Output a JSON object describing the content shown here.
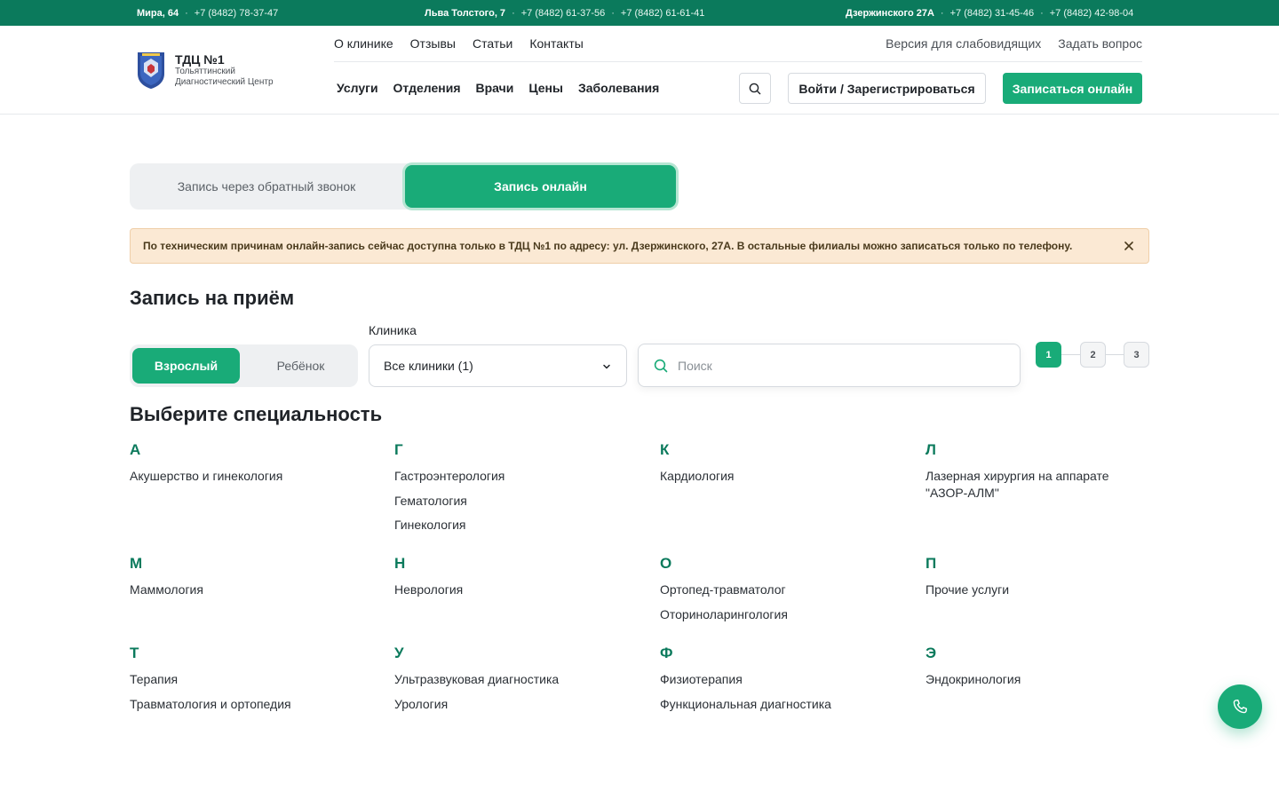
{
  "topbar": {
    "branches": [
      {
        "address": "Мира, 64",
        "phones": [
          "+7 (8482) 78-37-47"
        ]
      },
      {
        "address": "Льва Толстого, 7",
        "phones": [
          "+7 (8482) 61-37-56",
          "+7 (8482) 61-61-41"
        ]
      },
      {
        "address": "Дзержинского 27А",
        "phones": [
          "+7 (8482) 31-45-46",
          "+7 (8482) 42-98-04"
        ]
      }
    ]
  },
  "logo": {
    "title": "ТДЦ №1",
    "subtitle_line1": "Тольяттинский",
    "subtitle_line2": "Диагностический Центр"
  },
  "header": {
    "top_nav": [
      "О клинике",
      "Отзывы",
      "Статьи",
      "Контакты"
    ],
    "top_right": [
      "Версия для слабовидящих",
      "Задать вопрос"
    ],
    "main_nav": [
      "Услуги",
      "Отделения",
      "Врачи",
      "Цены",
      "Заболевания"
    ],
    "login_label": "Войти / Зарегистрироваться",
    "cta_label": "Записаться онлайн"
  },
  "mode": {
    "callback_label": "Запись через обратный звонок",
    "online_label": "Запись онлайн"
  },
  "alert": {
    "text": "По техническим причинам онлайн-запись сейчас доступна только в ТДЦ №1 по адресу: ул. Дзержинского, 27А. В остальные филиалы можно записаться только по телефону."
  },
  "booking": {
    "title": "Запись на приём",
    "adult_label": "Взрослый",
    "child_label": "Ребёнок",
    "clinic_label": "Клиника",
    "clinic_value": "Все клиники (1)",
    "search_placeholder": "Поиск",
    "steps": [
      "1",
      "2",
      "3"
    ],
    "active_step": 1
  },
  "specialties": {
    "title": "Выберите специальность",
    "groups": [
      {
        "letter": "А",
        "items": [
          "Акушерство и гинекология"
        ]
      },
      {
        "letter": "Г",
        "items": [
          "Гастроэнтерология",
          "Гематология",
          "Гинекология"
        ]
      },
      {
        "letter": "К",
        "items": [
          "Кардиология"
        ]
      },
      {
        "letter": "Л",
        "items": [
          "Лазерная хирургия на аппарате \"АЗОР-АЛМ\""
        ]
      },
      {
        "letter": "М",
        "items": [
          "Маммология"
        ]
      },
      {
        "letter": "Н",
        "items": [
          "Неврология"
        ]
      },
      {
        "letter": "О",
        "items": [
          "Ортопед-травматолог",
          "Оториноларингология"
        ]
      },
      {
        "letter": "П",
        "items": [
          "Прочие услуги"
        ]
      },
      {
        "letter": "Т",
        "items": [
          "Терапия",
          "Травматология и ортопедия"
        ]
      },
      {
        "letter": "У",
        "items": [
          "Ультразвуковая диагностика",
          "Урология"
        ]
      },
      {
        "letter": "Ф",
        "items": [
          "Физиотерапия",
          "Функциональная диагностика"
        ]
      },
      {
        "letter": "Э",
        "items": [
          "Эндокринология"
        ]
      }
    ]
  },
  "colors": {
    "brand_dark": "#0b7a5c",
    "brand": "#19ab78",
    "alert_bg": "#fbe9d4"
  },
  "icons": {
    "search": "search-icon",
    "close": "close-icon",
    "chevron": "chevron-down-icon",
    "phone": "phone-icon",
    "emblem": "clinic-emblem-icon"
  }
}
